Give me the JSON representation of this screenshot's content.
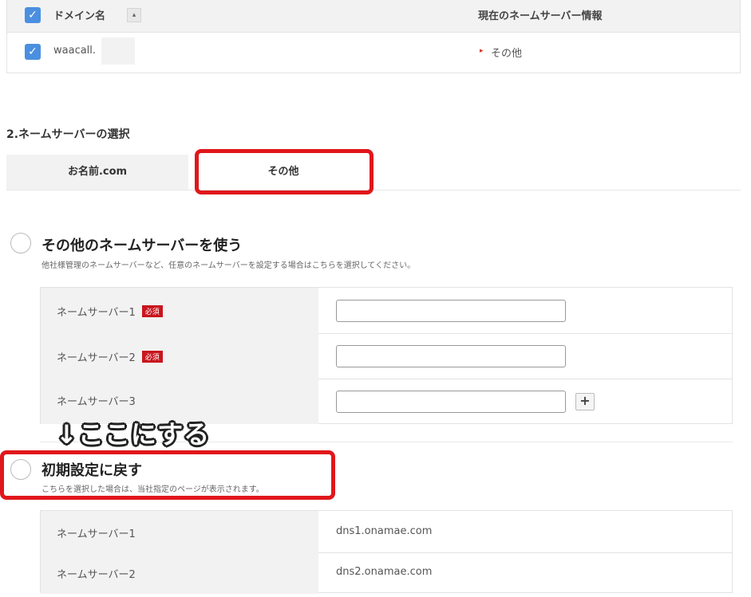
{
  "domain_table": {
    "header_label": "ドメイン名",
    "sort_icon": "sort-icon",
    "current_ns_header": "現在のネームサーバー情報",
    "rows": [
      {
        "domain": "waacall.",
        "current_ns": "その他",
        "checked": true
      }
    ]
  },
  "section": {
    "title": "2.ネームサーバーの選択"
  },
  "tabs": [
    {
      "label": "お名前.com",
      "active": false
    },
    {
      "label": "その他",
      "active": true
    }
  ],
  "option_other": {
    "title": "その他のネームサーバーを使う",
    "description": "他社様管理のネームサーバーなど、任意のネームサーバーを設定する場合はこちらを選択してください。",
    "rows": [
      {
        "label": "ネームサーバー1",
        "required": "必須"
      },
      {
        "label": "ネームサーバー2",
        "required": "必須"
      },
      {
        "label": "ネームサーバー3",
        "required": ""
      }
    ],
    "add_label": "+"
  },
  "annotation": {
    "arrow": "↓",
    "text": "ここにする"
  },
  "option_default": {
    "title": "初期設定に戻す",
    "description": "こちらを選択した場合は、当社指定のページが表示されます。",
    "rows": [
      {
        "label": "ネームサーバー1",
        "value": "dns1.onamae.com"
      },
      {
        "label": "ネームサーバー2",
        "value": "dns2.onamae.com"
      }
    ]
  },
  "colors": {
    "highlight_red": "#e0171b",
    "checkbox_blue": "#4a8fe0",
    "required_badge": "#c9151e"
  }
}
